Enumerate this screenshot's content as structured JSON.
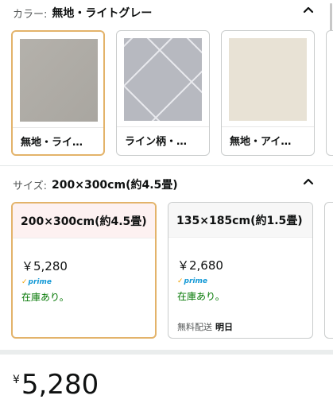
{
  "color": {
    "label": "カラー:",
    "value": "無地・ライトグレー",
    "options": [
      {
        "name": "無地・ライ…",
        "selected": true,
        "pattern": "plain-gray"
      },
      {
        "name": "ライン柄・…",
        "selected": false,
        "pattern": "diamond-lines"
      },
      {
        "name": "無地・アイ…",
        "selected": false,
        "pattern": "plain-ivory"
      }
    ]
  },
  "size": {
    "label": "サイズ:",
    "value": "200×300cm(約4.5畳)",
    "options": [
      {
        "title": "200×300cm(約4.5畳)",
        "price": "￥5,280",
        "prime": "prime",
        "stock": "在庫あり。",
        "selected": true
      },
      {
        "title": "135×185cm(約1.5畳)",
        "price": "￥2,680",
        "prime": "prime",
        "stock": "在庫あり。",
        "ship_label": "無料配送",
        "ship_day": "明日",
        "selected": false
      }
    ]
  },
  "price": {
    "currency": "¥",
    "amount": "5,280"
  },
  "colors": {
    "selected_border": "#e3b36a",
    "stock_green": "#007600",
    "prime_blue": "#1399d6"
  }
}
